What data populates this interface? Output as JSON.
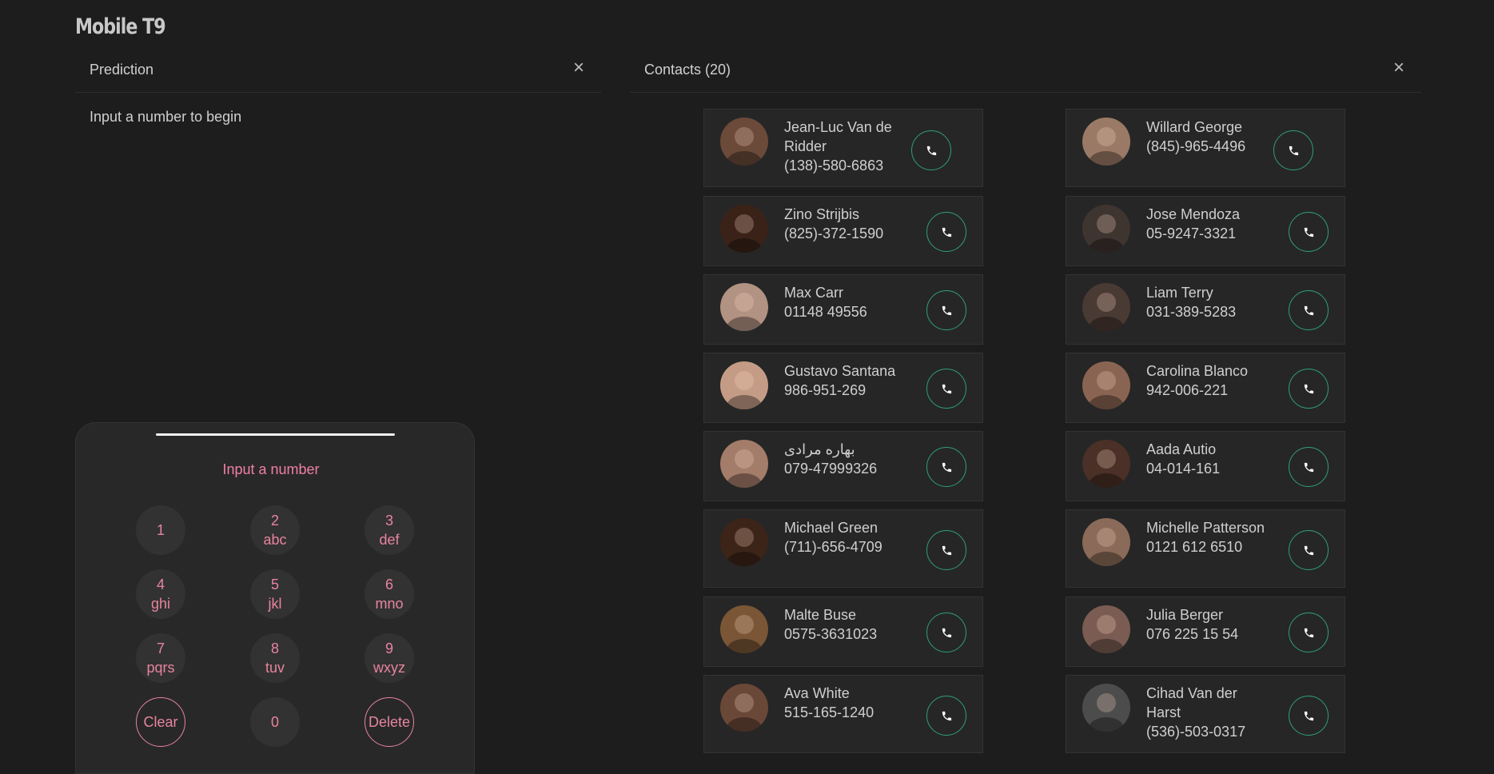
{
  "app": {
    "title": "Mobile T9"
  },
  "prediction": {
    "title": "Prediction",
    "close_icon": "×",
    "empty_text": "Input a number to begin"
  },
  "contacts_panel": {
    "title": "Contacts (20)",
    "close_icon": "×"
  },
  "phone": {
    "display_placeholder": "Input a number",
    "keys": [
      {
        "digit": "1",
        "letters": ""
      },
      {
        "digit": "2",
        "letters": "abc"
      },
      {
        "digit": "3",
        "letters": "def"
      },
      {
        "digit": "4",
        "letters": "ghi"
      },
      {
        "digit": "5",
        "letters": "jkl"
      },
      {
        "digit": "6",
        "letters": "mno"
      },
      {
        "digit": "7",
        "letters": "pqrs"
      },
      {
        "digit": "8",
        "letters": "tuv"
      },
      {
        "digit": "9",
        "letters": "wxyz"
      },
      {
        "digit": "Clear",
        "letters": ""
      },
      {
        "digit": "0",
        "letters": ""
      },
      {
        "digit": "Delete",
        "letters": ""
      }
    ]
  },
  "contacts": [
    {
      "name": "Jean-Luc Van de Ridder",
      "phone": "(138)-580-6863",
      "avatar_color": "#6b4a3a"
    },
    {
      "name": "Willard George",
      "phone": "(845)-965-4496",
      "avatar_color": "#9a7a66"
    },
    {
      "name": "Zino Strijbis",
      "phone": "(825)-372-1590",
      "avatar_color": "#3a2218"
    },
    {
      "name": "Jose Mendoza",
      "phone": "05-9247-3321",
      "avatar_color": "#3e3430"
    },
    {
      "name": "Max Carr",
      "phone": "01148 49556",
      "avatar_color": "#b29282"
    },
    {
      "name": "Liam Terry",
      "phone": "031-389-5283",
      "avatar_color": "#4a3a34"
    },
    {
      "name": "Gustavo Santana",
      "phone": "986-951-269",
      "avatar_color": "#c49c86"
    },
    {
      "name": "Carolina Blanco",
      "phone": "942-006-221",
      "avatar_color": "#8a6452"
    },
    {
      "name": "بهاره مرادی",
      "phone": "079-47999326",
      "avatar_color": "#a47c6a"
    },
    {
      "name": "Aada Autio",
      "phone": "04-014-161",
      "avatar_color": "#4a3026"
    },
    {
      "name": "Michael Green",
      "phone": "(711)-656-4709",
      "avatar_color": "#3d2418"
    },
    {
      "name": "Michelle Patterson",
      "phone": "0121 612 6510",
      "avatar_color": "#8a6a58"
    },
    {
      "name": "Malte Buse",
      "phone": "0575-3631023",
      "avatar_color": "#7a5636"
    },
    {
      "name": "Julia Berger",
      "phone": "076 225 15 54",
      "avatar_color": "#7a5c52"
    },
    {
      "name": "Ava White",
      "phone": "515-165-1240",
      "avatar_color": "#6a4838"
    },
    {
      "name": "Cihad Van der Harst",
      "phone": "(536)-503-0317",
      "avatar_color": "#4c4c4c"
    }
  ],
  "call_icon": "phone-icon",
  "colors": {
    "accent_pink": "#e8849f",
    "call_green": "#2f9e7d",
    "background": "#1d1d1d"
  }
}
